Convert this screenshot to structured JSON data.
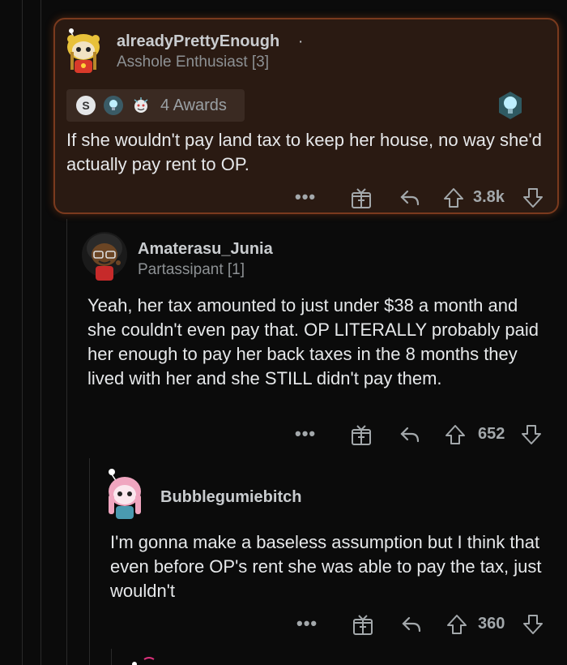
{
  "comments": [
    {
      "username": "alreadyPrettyEnough",
      "separator": "·",
      "flair": "Asshole Enthusiast [3]",
      "awards_label": "4 Awards",
      "body": "If she wouldn't pay land tax to keep her house, no way she'd actually pay rent to OP.",
      "score": "3.8k"
    },
    {
      "username": "Amaterasu_Junia",
      "flair": "Partassipant [1]",
      "body": "Yeah, her tax amounted to just under $38 a month and she couldn't even pay that. OP LITERALLY probably paid her enough to pay her back taxes in the 8 months they lived with her and she STILL didn't pay them.",
      "score": "652"
    },
    {
      "username": "Bubblegumiebitch",
      "body": "I'm gonna make a baseless assumption but I think that even before OP's rent she was able to pay the tax, just wouldn't",
      "score": "360"
    }
  ],
  "actions": {
    "more": "•••"
  },
  "colors": {
    "highlight_border": "#7a3a1e",
    "highlight_bg": "#2a1a12"
  }
}
